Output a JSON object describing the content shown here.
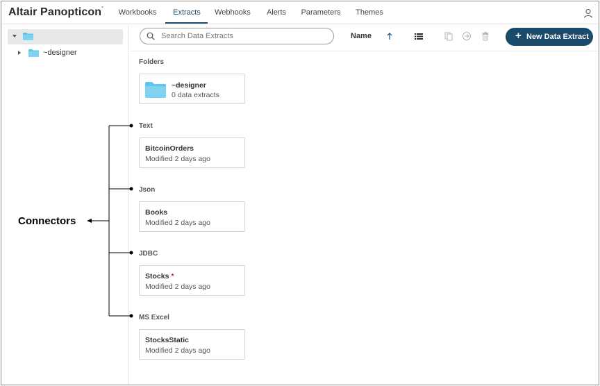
{
  "app": {
    "brand": "Altair Panopticon",
    "brand_mark": "°"
  },
  "nav": {
    "tabs": [
      {
        "label": "Workbooks"
      },
      {
        "label": "Extracts"
      },
      {
        "label": "Webhooks"
      },
      {
        "label": "Alerts"
      },
      {
        "label": "Parameters"
      },
      {
        "label": "Themes"
      }
    ],
    "active": "Extracts"
  },
  "sidebar": {
    "tree_child_label": "~designer"
  },
  "toolbar": {
    "search_placeholder": "Search Data Extracts",
    "sort_label": "Name",
    "new_button_label": "New Data Extract"
  },
  "sections": {
    "folders": "Folders",
    "text": "Text",
    "json": "Json",
    "jdbc": "JDBC",
    "msexcel": "MS Excel"
  },
  "cards": {
    "folder": {
      "title": "~designer",
      "sub": "0 data extracts"
    },
    "bitcoin": {
      "title": "BitcoinOrders",
      "sub": "Modified 2 days ago"
    },
    "books": {
      "title": "Books",
      "sub": "Modified 2 days ago"
    },
    "stocks": {
      "title": "Stocks",
      "star": "*",
      "sub": "Modified 2 days ago"
    },
    "stocksstatic": {
      "title": "StocksStatic",
      "sub": "Modified 2 days ago"
    }
  },
  "annotation": {
    "label": "Connectors"
  },
  "colors": {
    "accent": "#1b4a6b",
    "folder": "#7fd3f0",
    "required_star": "#e02020"
  }
}
